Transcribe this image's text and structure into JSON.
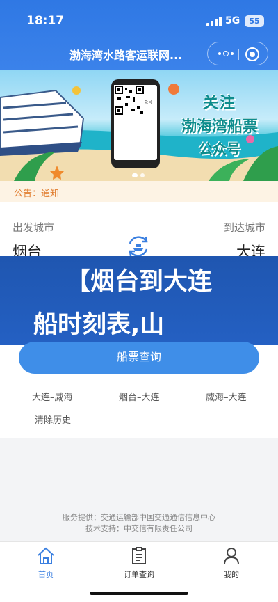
{
  "status": {
    "time": "18:17",
    "network": "5G",
    "battery": "55"
  },
  "nav": {
    "title": "渤海湾水路客运联网..."
  },
  "banner": {
    "line1": "关注",
    "line2": "渤海湾船票",
    "line3": "公众号",
    "phone_caption": "渤海湾船票公众号"
  },
  "notice": {
    "text": "公告：通知"
  },
  "route": {
    "from_label": "出发城市",
    "to_label": "到达城市",
    "from_city": "烟台",
    "to_city": "大连"
  },
  "promo": {
    "line1": "【烟台到大连",
    "line2": "船时刻表,山"
  },
  "query_button": "船票查询",
  "history": [
    "大连–威海",
    "烟台–大连",
    "威海–大连"
  ],
  "clear_history": "清除历史",
  "footer": {
    "service": "服务提供：交通运输部中国交通通信信息中心",
    "support": "技术支持：中交信有限责任公司"
  },
  "tabs": [
    {
      "label": "首页",
      "icon": "home-icon",
      "active": true
    },
    {
      "label": "订单查询",
      "icon": "order-icon",
      "active": false
    },
    {
      "label": "我的",
      "icon": "user-icon",
      "active": false
    }
  ],
  "colors": {
    "primary": "#3a7fe0",
    "button": "#3f8ee8",
    "notice": "#e07b2c",
    "promo": "#2460c3"
  }
}
